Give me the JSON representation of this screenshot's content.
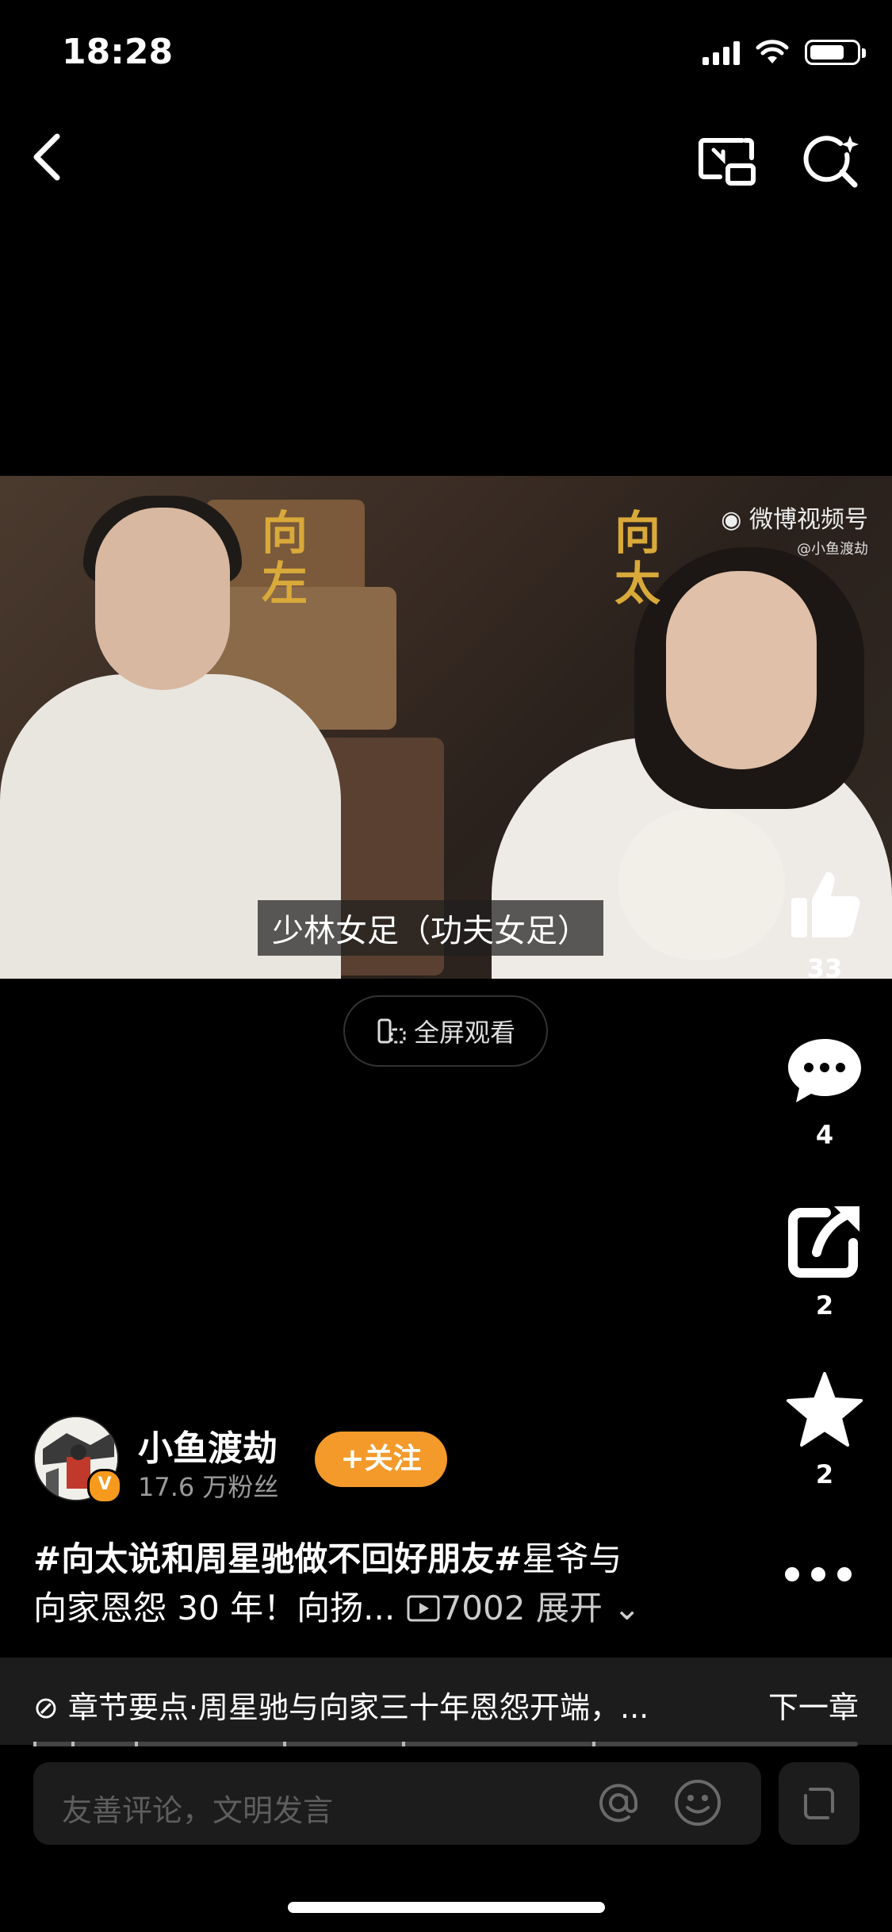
{
  "status_bar": {
    "time": "18:28",
    "battery_level": 0.75
  },
  "nav": {
    "back_icon": "chevron-left-icon",
    "pip_icon": "picture-in-picture-icon",
    "search_icon": "ai-search-icon"
  },
  "video": {
    "caption_left": "向左",
    "caption_right": "向太",
    "watermark_brand": "微博视频号",
    "watermark_user": "@小鱼渡劫",
    "subtitle": "少林女足（功夫女足）"
  },
  "fullscreen": {
    "label": "全屏观看"
  },
  "actions": {
    "like_count": "33",
    "comment_count": "4",
    "share_count": "2",
    "favorite_count": "2"
  },
  "author": {
    "name": "小鱼渡劫",
    "fans": "17.6 万粉丝",
    "follow_label": "关注",
    "verified": "V"
  },
  "description": {
    "hashtag": "#向太说和周星驰做不回好朋友#",
    "text_line1": "星爷与",
    "text_line2": "向家恩怨 30 年！向扬...",
    "play_count": "7002",
    "expand_label": "展开"
  },
  "chapter": {
    "text": "章节要点·周星驰与向家三十年恩怨开端，...",
    "next_label": "下一章",
    "progress": 0.0
  },
  "comment": {
    "placeholder": "友善评论，文明发言"
  }
}
